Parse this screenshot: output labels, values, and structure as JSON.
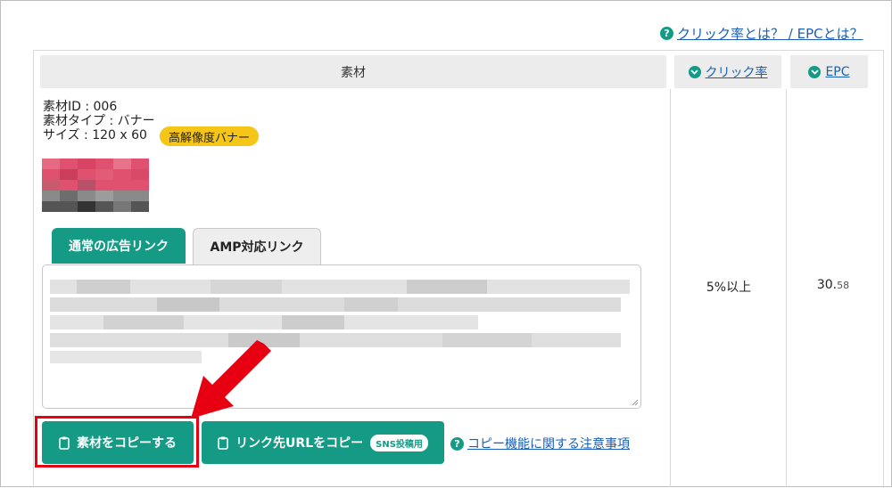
{
  "help_top": {
    "icon": "question-icon",
    "text": "クリック率とは？ / EPCとは？"
  },
  "table": {
    "header_material": "素材",
    "header_ctr": "クリック率",
    "header_epc": "EPC"
  },
  "material": {
    "id_line": "素材ID : 006",
    "type_line": "素材タイプ : バナー",
    "size_line": "サイズ : 120 x 60",
    "badge": "高解像度バナー"
  },
  "tabs": {
    "normal": "通常の広告リンク",
    "amp": "AMP対応リンク"
  },
  "buttons": {
    "copy_material": "素材をコピーする",
    "copy_url": "リンク先URLをコピー",
    "sns_badge": "SNS投稿用"
  },
  "help_bottom": {
    "text": "コピー機能に関する注意事項"
  },
  "row": {
    "ctr": "5%以上",
    "epc_main": "30.",
    "epc_decimal": "58"
  },
  "colors": {
    "accent": "#159a86",
    "link": "#1a5fb4",
    "badge": "#f5c518",
    "highlight": "#e60012"
  }
}
